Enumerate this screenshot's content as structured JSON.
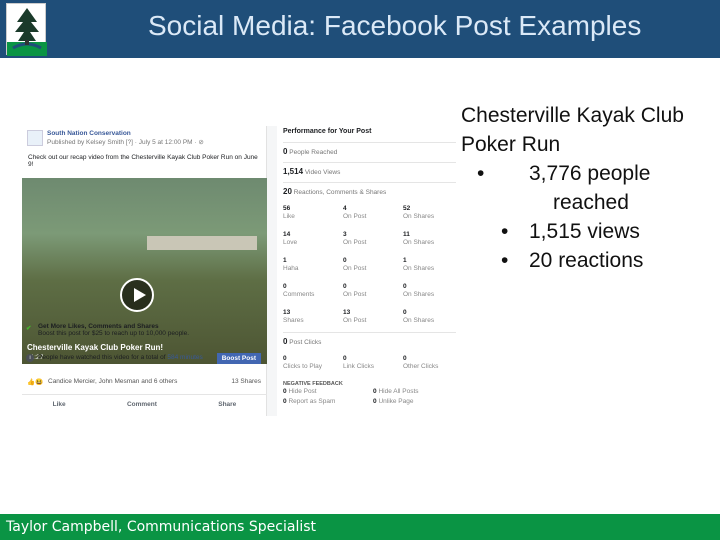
{
  "slide": {
    "title": "Social Media: Facebook Post Examples",
    "footer": "Taylor Campbell, Communications Specialist",
    "heading": "Chesterville Kayak Club Poker Run",
    "bullets": [
      "3,776 people reached",
      "1,515 views",
      "20 reactions"
    ]
  },
  "colors": {
    "header": "#1f4e79",
    "footer": "#0a9444"
  },
  "post": {
    "page_name": "South Nation Conservation",
    "meta": "Published by Kelsey Smith [?] · July 5 at 12:00 PM · ⊘",
    "text": "Check out our recap video from the Chesterville Kayak Club Poker Run on June 9!",
    "video_title": "Chesterville Kayak Club Poker Run!",
    "video_time": "01:27",
    "boost_title": "Get More Likes, Comments and Shares",
    "boost_desc": "Boost this post for $25 to reach up to 10,000 people.",
    "watched_text": "People have watched this video for a total of",
    "watched_mins": "584 minutes",
    "boost_button": "Boost Post",
    "reactors": "Candice Mercier, John Mesman and 6 others",
    "shares": "13 Shares",
    "actions": [
      "Like",
      "Comment",
      "Share"
    ]
  },
  "performance": {
    "title": "Performance for Your Post",
    "people_reached": {
      "value": "0",
      "label": "People Reached"
    },
    "video_views": {
      "value": "1,514",
      "label": "Video Views"
    },
    "reactions": {
      "value": "20",
      "label": "Reactions, Comments & Shares"
    },
    "rows": [
      [
        {
          "v": "56",
          "l": "Like"
        },
        {
          "v": "4",
          "l": "On Post"
        },
        {
          "v": "52",
          "l": "On Shares"
        }
      ],
      [
        {
          "v": "14",
          "l": "Love"
        },
        {
          "v": "3",
          "l": "On Post"
        },
        {
          "v": "11",
          "l": "On Shares"
        }
      ],
      [
        {
          "v": "1",
          "l": "Haha"
        },
        {
          "v": "0",
          "l": "On Post"
        },
        {
          "v": "1",
          "l": "On Shares"
        }
      ],
      [
        {
          "v": "0",
          "l": "Comments"
        },
        {
          "v": "0",
          "l": "On Post"
        },
        {
          "v": "0",
          "l": "On Shares"
        }
      ],
      [
        {
          "v": "13",
          "l": "Shares"
        },
        {
          "v": "13",
          "l": "On Post"
        },
        {
          "v": "0",
          "l": "On Shares"
        }
      ]
    ],
    "post_clicks": {
      "value": "0",
      "label": "Post Clicks"
    },
    "click_row": [
      {
        "v": "0",
        "l": "Clicks to Play"
      },
      {
        "v": "0",
        "l": "Link Clicks"
      },
      {
        "v": "0",
        "l": "Other Clicks"
      }
    ],
    "negative_title": "NEGATIVE FEEDBACK",
    "negative": [
      {
        "v": "0",
        "l": "Hide Post"
      },
      {
        "v": "0",
        "l": "Hide All Posts"
      },
      {
        "v": "0",
        "l": "Report as Spam"
      },
      {
        "v": "0",
        "l": "Unlike Page"
      }
    ]
  }
}
